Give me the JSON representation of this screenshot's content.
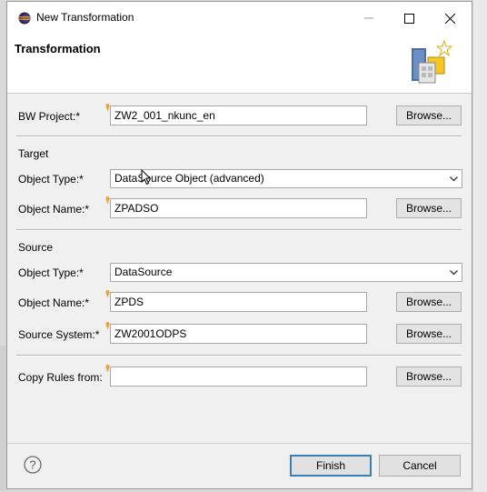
{
  "window": {
    "title": "New Transformation"
  },
  "header": {
    "title": "Transformation"
  },
  "bw_project": {
    "label": "BW Project:*",
    "value": "ZW2_001_nkunc_en",
    "browse_label": "Browse..."
  },
  "target": {
    "section_label": "Target",
    "object_type_label": "Object Type:*",
    "object_type_value": "DataSource Object (advanced)",
    "object_name_label": "Object Name:*",
    "object_name_value": "ZPADSO",
    "browse_label": "Browse..."
  },
  "source": {
    "section_label": "Source",
    "object_type_label": "Object Type:*",
    "object_type_value": "DataSource",
    "object_name_label": "Object Name:*",
    "object_name_value": "ZPDS",
    "object_browse_label": "Browse...",
    "source_system_label": "Source System:*",
    "source_system_value": "ZW2001ODPS",
    "source_system_browse_label": "Browse..."
  },
  "copy_rules": {
    "label": "Copy Rules from:",
    "value": "",
    "browse_label": "Browse..."
  },
  "footer": {
    "finish_label": "Finish",
    "cancel_label": "Cancel"
  },
  "colors": {
    "accent": "#3c7fb1",
    "required_marker": "#f0a030"
  }
}
